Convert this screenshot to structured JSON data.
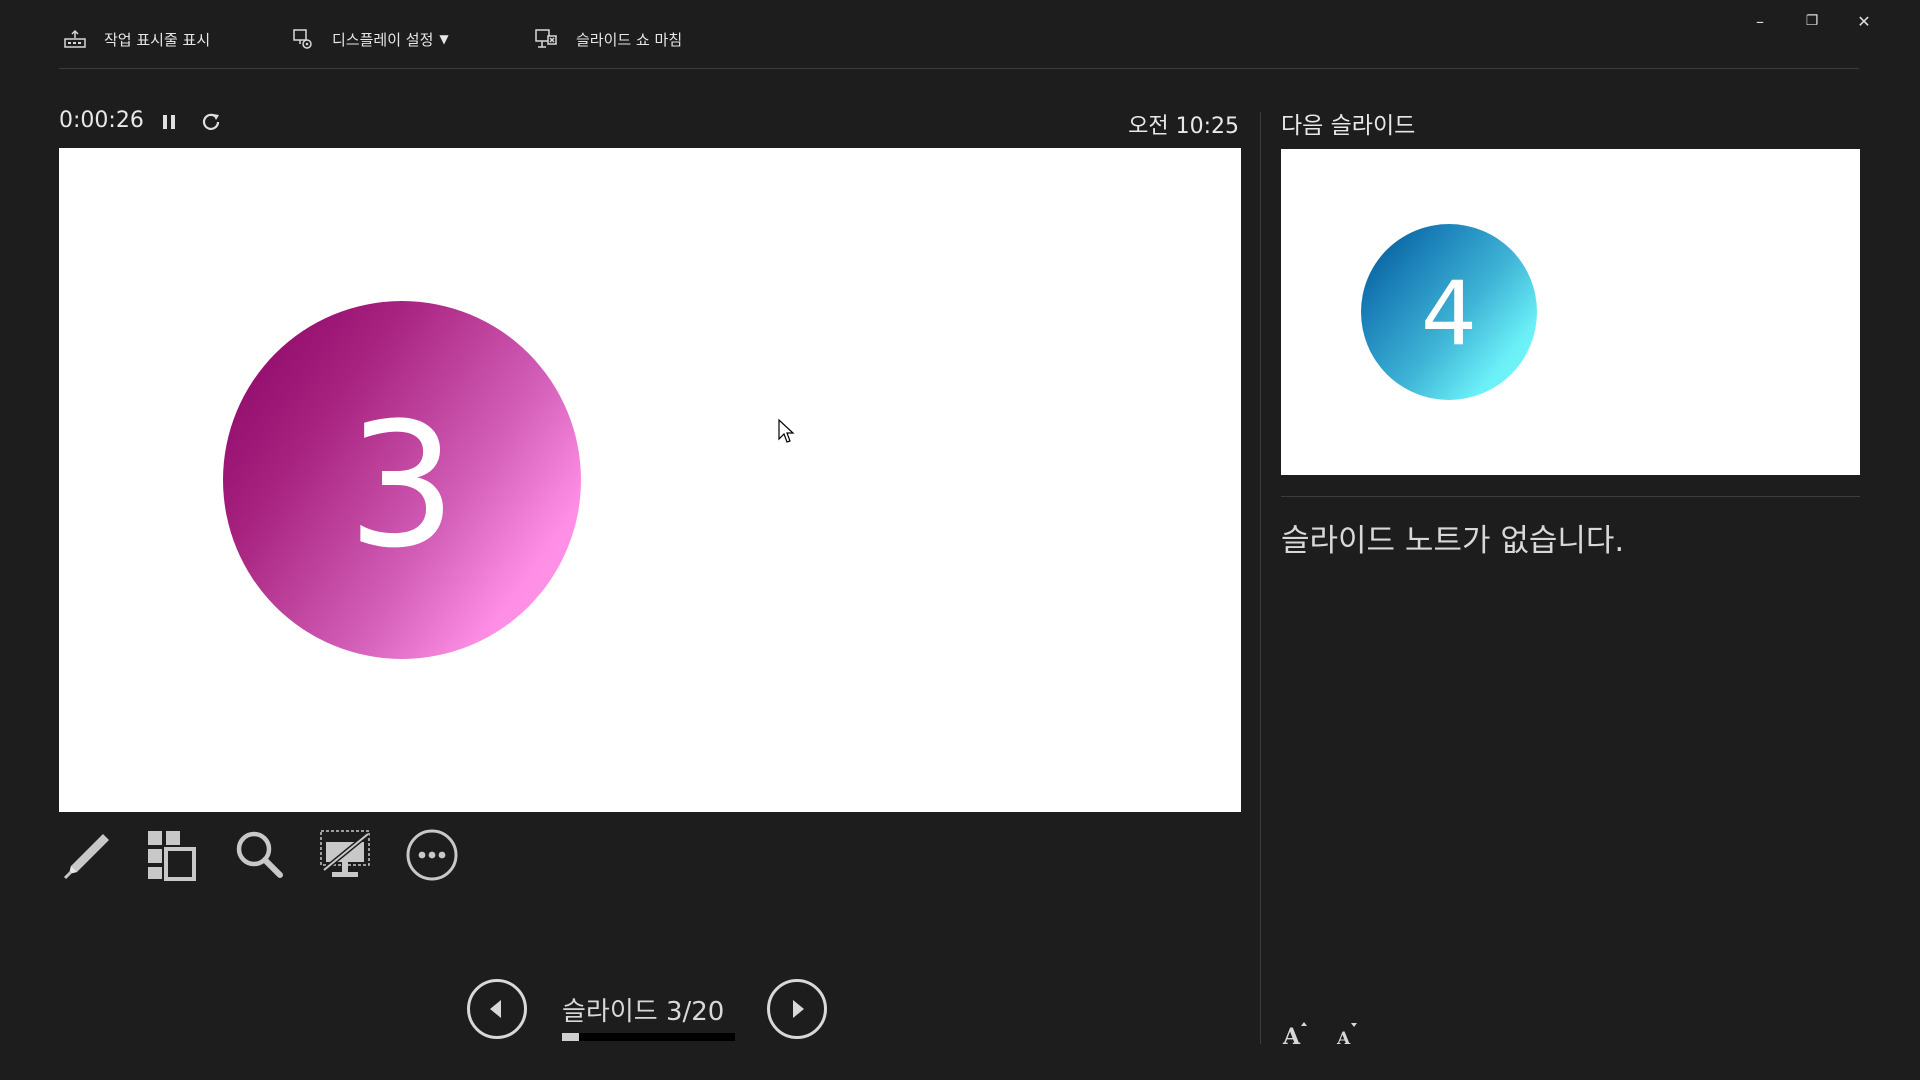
{
  "toolbar": {
    "show_taskbar": "작업 표시줄 표시",
    "display_settings": "디스플레이 설정",
    "end_slideshow": "슬라이드 쇼 마침"
  },
  "window": {
    "minimize_glyph": "–",
    "restore_glyph": "❐",
    "close_glyph": "✕"
  },
  "timer": {
    "elapsed": "0:00:26"
  },
  "clock": {
    "time": "오전 10:25"
  },
  "current_slide": {
    "number_text": "3",
    "circle_gradient": [
      "#870063",
      "#ff94e6"
    ]
  },
  "navigation": {
    "slide_counter": "슬라이드 3/20",
    "current": 3,
    "total": 20
  },
  "next_slide": {
    "title": "다음 슬라이드",
    "number_text": "4",
    "circle_gradient": [
      "#004f8c",
      "#78fbfb"
    ]
  },
  "notes": {
    "empty_text": "슬라이드 노트가 없습니다."
  },
  "icons": {
    "taskbar": "taskbar-icon",
    "display_settings": "display-settings-icon",
    "end_show": "end-slideshow-icon",
    "pause": "pause-icon",
    "restart": "restart-icon",
    "pen": "pen-icon",
    "all_slides": "all-slides-icon",
    "zoom": "zoom-icon",
    "black_screen": "black-screen-icon",
    "more": "more-options-icon"
  },
  "colors": {
    "background": "#1d1d1d",
    "text": "#e8e8e8",
    "slide_bg": "#ffffff"
  }
}
